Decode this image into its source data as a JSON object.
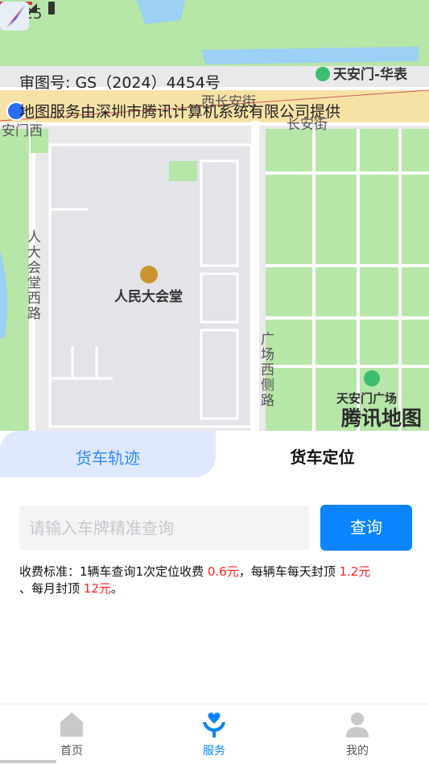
{
  "status_bar": {
    "time": "4:25"
  },
  "map": {
    "approval_no": "审图号: GS（2024）4454号",
    "provider_notice": "地图服务由深圳市腾讯计算机系统有限公司提供",
    "poi": {
      "tiananmen_huabiao": "天安门-华表",
      "changan_gate": "长安街",
      "xichang_an_jie": "西长安街",
      "tiananmen_west": "安门西",
      "great_hall": "人民大会堂",
      "great_hall_west_road": "人大会堂西路",
      "square_west_road": "广场西侧路",
      "tiananmen_square": "天安门广场"
    },
    "logo_text": "腾讯地图",
    "colors": {
      "park": "#b6e6a8",
      "water": "#9dd0f5",
      "building": "#eceef2",
      "road": "#ffffff",
      "main_road": "#f7e2a6"
    }
  },
  "tabs": [
    {
      "label": "货车轨迹",
      "active": false
    },
    {
      "label": "货车定位",
      "active": true
    }
  ],
  "search": {
    "placeholder": "请输入车牌精准查询",
    "value": "",
    "button_label": "查询"
  },
  "fee": {
    "prefix": "收费标准：1辆车查询1次定位收费 ",
    "per_query": "0.6元",
    "mid": "，每辆车每天封顶 ",
    "daily_cap": "1.2元",
    "sep": "、每月封顶 ",
    "monthly_cap": "12元",
    "suffix": "。"
  },
  "bottom_nav": [
    {
      "label": "首页",
      "icon": "home-icon",
      "active": false
    },
    {
      "label": "服务",
      "icon": "service-icon",
      "active": true
    },
    {
      "label": "我的",
      "icon": "profile-icon",
      "active": false
    }
  ],
  "accent_color": "#0a84ff",
  "price_color": "#ff2020"
}
